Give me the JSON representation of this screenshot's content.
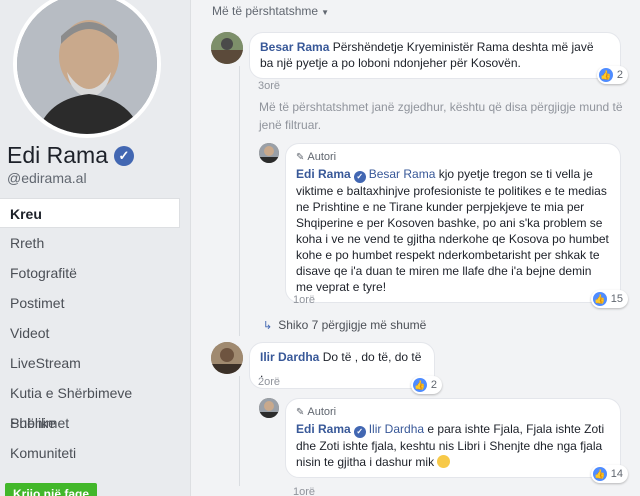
{
  "page": {
    "name": "Edi Rama",
    "handle": "@edirama.al"
  },
  "nav": {
    "items": [
      {
        "label": "Kreu",
        "active": true
      },
      {
        "label": "Rreth"
      },
      {
        "label": "Fotografitë"
      },
      {
        "label": "Postimet"
      },
      {
        "label": "Videot"
      },
      {
        "label": "LiveStream"
      },
      {
        "label": "Kutia e Shërbimeve Publike"
      },
      {
        "label": "Shënimet"
      },
      {
        "label": "Komuniteti"
      }
    ],
    "create_page_label": "Krijo një faqe"
  },
  "comments": {
    "sort_label": "Më të përshtatshme",
    "notice": "Më të përshtatshmet janë zgjedhur, kështu që disa përgjigje mund të jenë filtruar.",
    "c1": {
      "author": "Besar Rama",
      "text": "Përshëndetje Kryeministër Rama deshta më javë ba një pyetje a po loboni ndonjeher për Kosovën.",
      "time": "3orë",
      "likes": "2"
    },
    "r1": {
      "badge": "Autori",
      "author": "Edi Rama",
      "mention": "Besar Rama",
      "text": "kjo pyetje tregon se ti vella je viktime e baltaxhinjve profesioniste te politikes e te medias ne Prishtine e ne Tirane kunder perpjekjeve te mia per Shqiperine e per Kosoven bashke, po ani s'ka problem se koha i ve ne vend te gjitha nderkohe qe Kosova po humbet kohe e po humbet respekt nderkombetarisht per shkak te disave qe i'a duan te miren me llafe dhe i'a bejne demin me veprat e tyre!",
      "time": "1orë",
      "likes": "15"
    },
    "more_replies": "Shiko 7 përgjigje më shumë",
    "c2": {
      "author": "Ilir Dardha",
      "text": "Do të , do të, do të .",
      "time": "2orë",
      "likes": "2"
    },
    "r2": {
      "badge": "Autori",
      "author": "Edi Rama",
      "mention": "Ilir Dardha",
      "text": "e para ishte Fjala, Fjala ishte Zoti dhe Zoti ishte fjala, keshtu nis Libri i Shenjte dhe nga fjala nisin te gjitha i dashur mik",
      "time": "1orë",
      "likes": "14"
    }
  },
  "icons": {
    "verified": "verified-check-icon",
    "like": "like-thumb-icon",
    "reply": "reply-arrow-icon",
    "author_badge": "pen-icon",
    "emoji": "smile-emoji-icon"
  },
  "colors": {
    "link": "#385898",
    "verified": "#4267b2",
    "create_button": "#42b72a"
  }
}
